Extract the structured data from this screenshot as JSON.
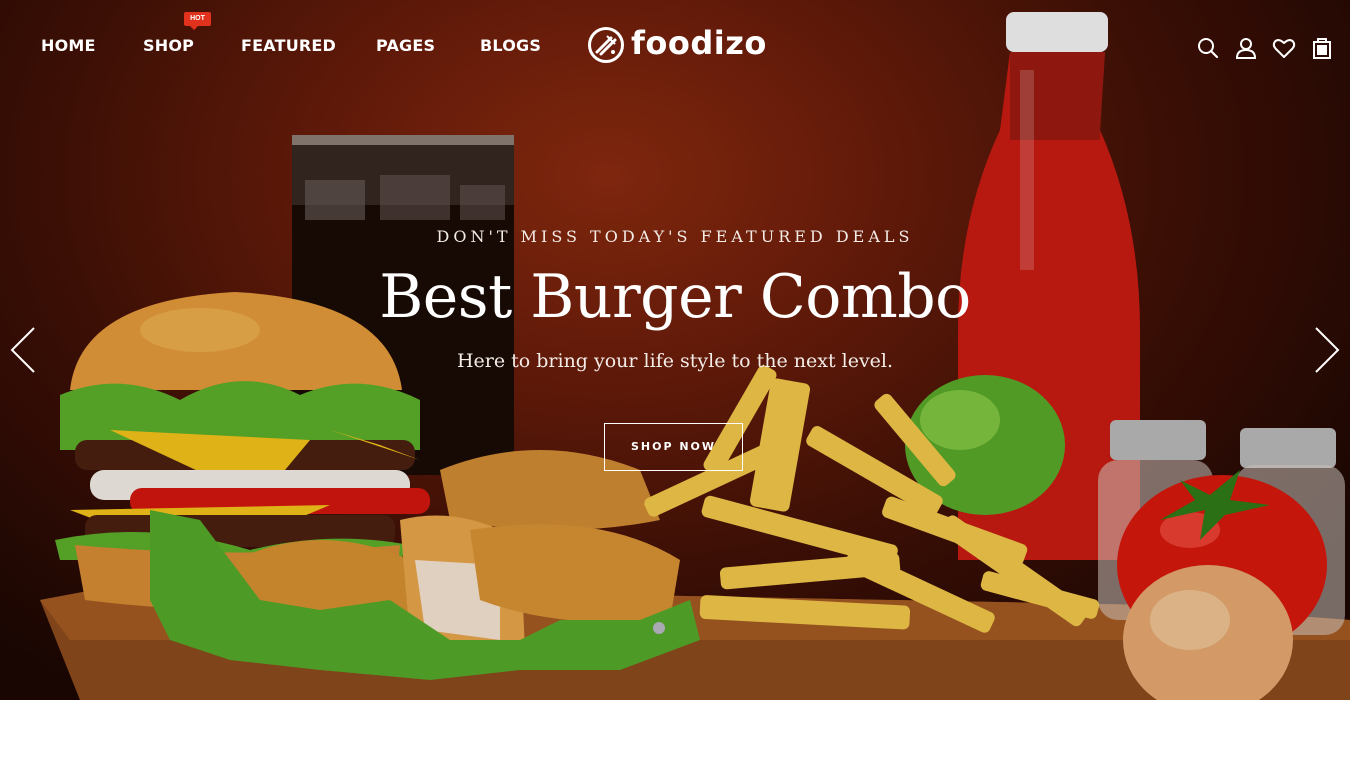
{
  "nav": {
    "home": "HOME",
    "shop": "SHOP",
    "shop_badge": "HOT",
    "featured": "FEATURED",
    "pages": "PAGES",
    "blogs": "BLOGS"
  },
  "brand": {
    "name": "foodizo"
  },
  "header_icons": [
    "search-icon",
    "user-icon",
    "heart-icon",
    "shopping-bag-icon"
  ],
  "hero": {
    "subtitle": "DON'T MISS TODAY'S FEATURED DEALS",
    "headline": "Best Burger Combo",
    "tagline": "Here to bring your life style to the next level.",
    "cta": "SHOP NOW",
    "active_slide": 1
  },
  "colors": {
    "badge": "#e0321c",
    "text": "#ffffff",
    "dot_active": "#a9a9b3"
  }
}
